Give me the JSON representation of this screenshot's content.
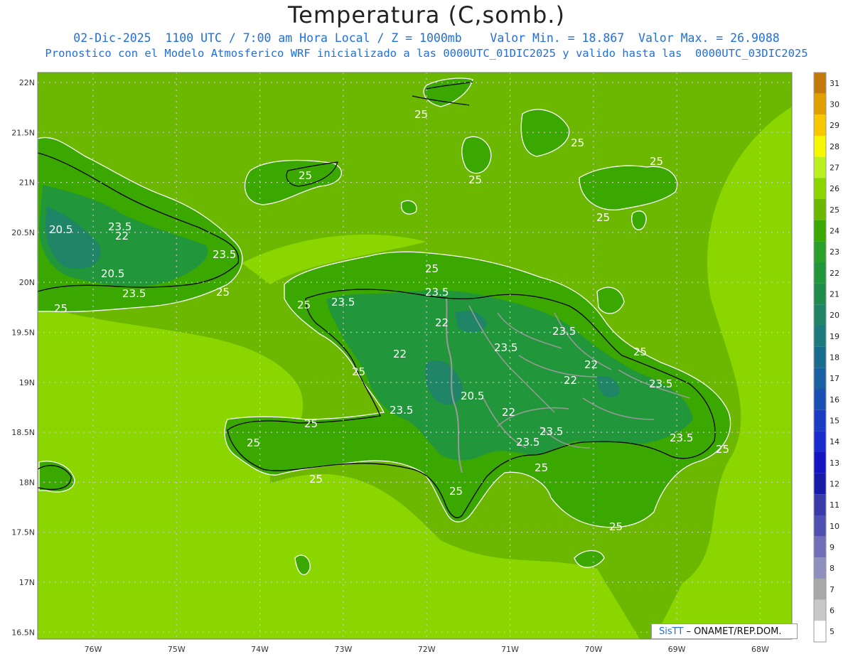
{
  "header": {
    "title": "Temperatura (C,somb.)",
    "line1": "02-Dic-2025  1100 UTC / 7:00 am Hora Local / Z = 1000mb    Valor Min. = 18.867  Valor Max. = 26.9088",
    "line2": "Pronostico con el Modelo Atmosferico WRF inicializado a las 0000UTC_01DIC2025 y valido hasta las  0000UTC_03DIC2025"
  },
  "axes": {
    "lat_labels": [
      "22N",
      "21.5N",
      "21N",
      "20.5N",
      "20N",
      "19.5N",
      "19N",
      "18.5N",
      "18N",
      "17.5N",
      "17N",
      "16.5N"
    ],
    "lon_labels": [
      "76W",
      "75W",
      "74W",
      "73W",
      "72W",
      "71W",
      "70W",
      "69W",
      "68W"
    ]
  },
  "colorbar": {
    "labels": [
      "31",
      "30",
      "29",
      "28",
      "27",
      "26",
      "25",
      "24",
      "23",
      "22",
      "21",
      "20",
      "19",
      "18",
      "17",
      "16",
      "15",
      "14",
      "13",
      "12",
      "11",
      "10",
      "9",
      "8",
      "7",
      "6",
      "5"
    ],
    "colors": [
      "#c47a0a",
      "#e0a000",
      "#f7c700",
      "#f7f700",
      "#b8f020",
      "#8cd600",
      "#6cb800",
      "#3aa800",
      "#2aa02a",
      "#22963a",
      "#1f8c4e",
      "#1f8566",
      "#1d7a7a",
      "#1a6c8c",
      "#1a5fa0",
      "#1a4fb4",
      "#1a3cc4",
      "#1a2acc",
      "#1414c0",
      "#1a1aa8",
      "#3a3aa8",
      "#5050b0",
      "#7070b8",
      "#9090c0",
      "#a8a8a8",
      "#c8c8c8",
      "#ffffff"
    ]
  },
  "contour_labels": {
    "c25": "25",
    "c235": "23.5",
    "c22": "22",
    "c205": "20.5"
  },
  "credit": {
    "sis": "SisTT",
    "rest": "– ONAMET/REP.DOM."
  }
}
